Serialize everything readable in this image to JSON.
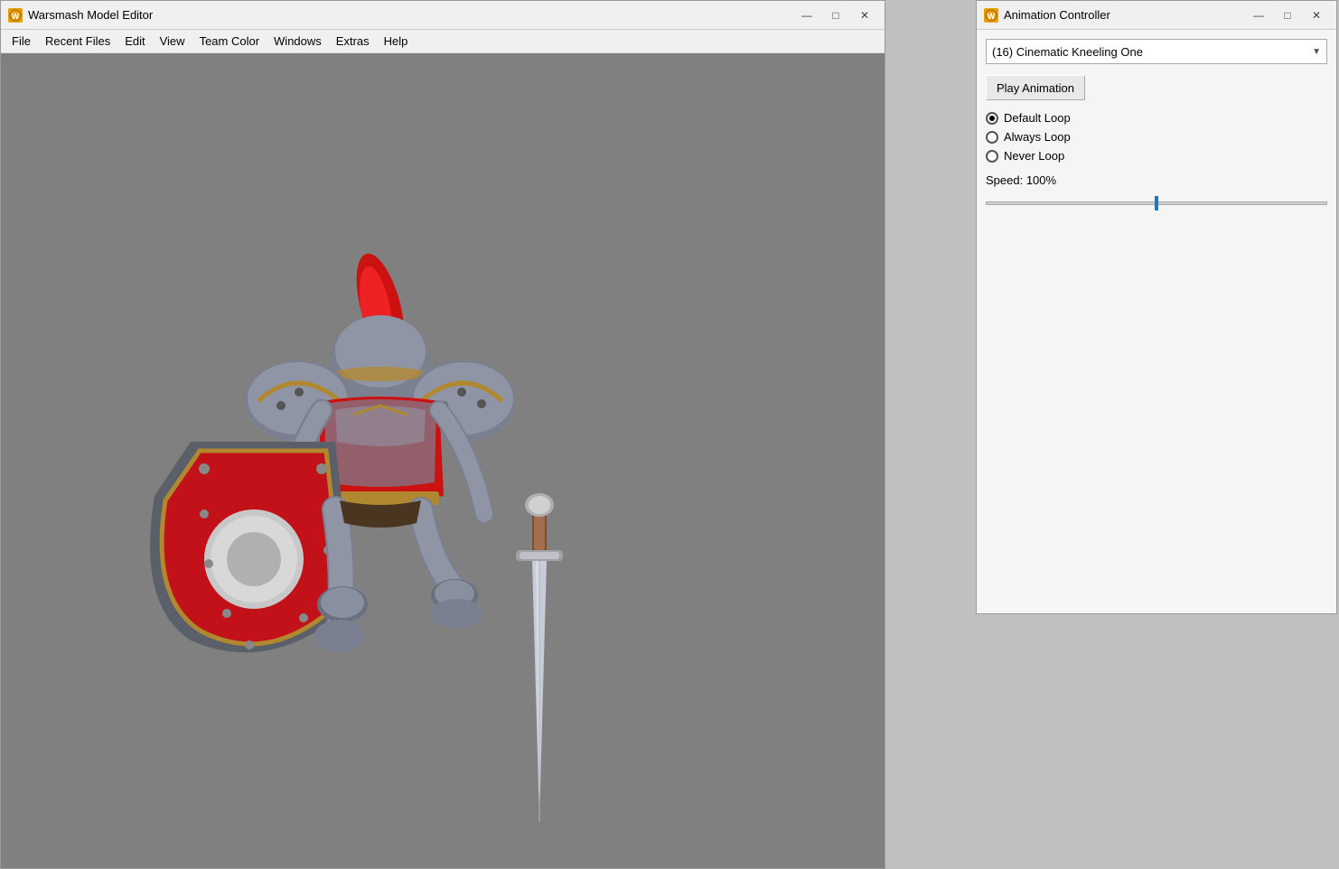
{
  "editor_window": {
    "title": "Warsmash Model Editor",
    "icon_label": "W",
    "minimize_btn": "—",
    "maximize_btn": "□",
    "close_btn": "✕"
  },
  "menu": {
    "items": [
      "File",
      "Recent Files",
      "Edit",
      "View",
      "Team Color",
      "Windows",
      "Extras",
      "Help"
    ]
  },
  "anim_window": {
    "title": "Animation Controller",
    "icon_label": "W",
    "minimize_btn": "—",
    "maximize_btn": "□",
    "close_btn": "✕",
    "dropdown_value": "(16) Cinematic Kneeling One",
    "play_button_label": "Play Animation",
    "loop_options": [
      {
        "label": "Default Loop",
        "checked": true
      },
      {
        "label": "Always Loop",
        "checked": false
      },
      {
        "label": "Never Loop",
        "checked": false
      }
    ],
    "speed_label": "Speed:  100%",
    "speed_value": 100
  }
}
